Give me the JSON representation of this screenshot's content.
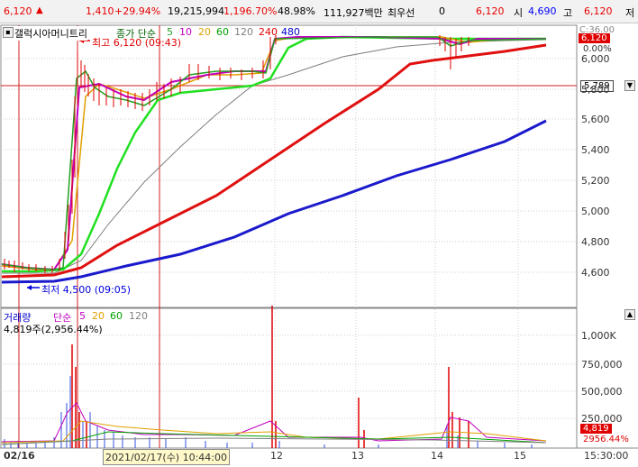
{
  "top_bar": {
    "price": "6,120",
    "change": "1,410",
    "change_pct": "+29.94%",
    "volume": "19,215,994",
    "volume_ratio": "1,196.70%",
    "turnover": "48.98%",
    "amount": "111,927백만",
    "order_label": "최우선",
    "order_value": "0",
    "ask": "6,120",
    "open_label": "시",
    "open_value": "4,690",
    "high_label": "고",
    "high_value": "6,120",
    "low_label": "저"
  },
  "price_pane": {
    "stock_name": "갤럭시아머니트리",
    "ma_label": "종가 단순",
    "ma_periods": [
      "5",
      "10",
      "20",
      "60",
      "120",
      "240",
      "480"
    ],
    "high_annotation": "최고 6,120 (09:43)",
    "low_annotation": "최저 4,500 (09:05)",
    "current_price_badge": "6,120",
    "change_badge": "0.00%",
    "crosshair_badge": "5,789",
    "top_right_label": "C:36.00",
    "y_ticks": [
      "6,000",
      "5,800",
      "5,600",
      "5,400",
      "5,200",
      "5,000",
      "4,800",
      "4,600"
    ]
  },
  "volume_pane": {
    "title": "거래량",
    "ma_label": "단순",
    "ma_periods": [
      "5",
      "20",
      "60",
      "120"
    ],
    "current_volume": "4,819주(2,956.44%)",
    "badge_volume": "4,819",
    "badge_pct": "2956.44%",
    "y_ticks": [
      "1,000K",
      "750,000",
      "500,000",
      "250,000"
    ]
  },
  "x_axis": {
    "start_label": "02/16",
    "crosshair_time": "2021/02/17(수) 10:44:00",
    "ticks": [
      "12",
      "13",
      "14",
      "15"
    ],
    "end_label": "15:30:00"
  },
  "colors": {
    "up": "#e60000",
    "down": "#0000ff",
    "ma5": "#22a022",
    "ma10": "#c000c0",
    "ma20": "#e0a000",
    "ma60": "#00a000",
    "ma120": "#7a7a7a",
    "ma240": "#e60000",
    "ma480": "#0000cc"
  }
}
